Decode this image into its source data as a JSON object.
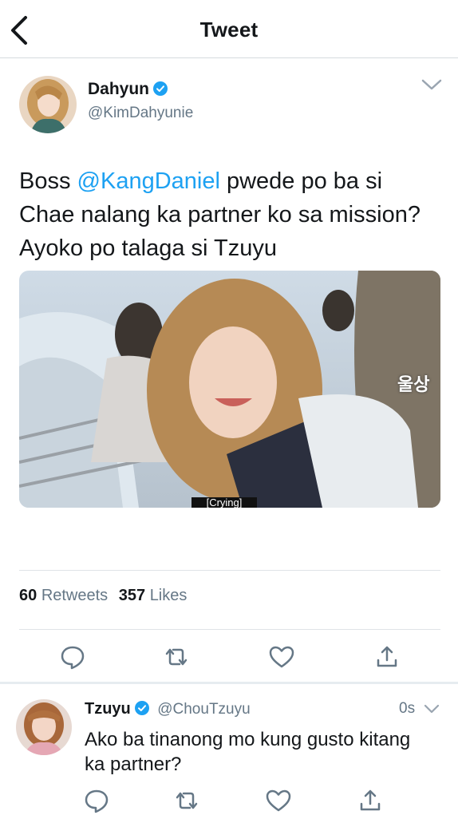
{
  "header": {
    "title": "Tweet",
    "back_icon": "back-chevron-icon"
  },
  "tweet": {
    "author_name": "Dahyun",
    "author_handle": "@KimDahyunie",
    "text_before": "Boss ",
    "mention": "@KangDaniel",
    "text_after": " pwede po ba si Chae nalang ka partner ko sa mission? Ayoko po talaga si Tzuyu",
    "image_caption": "울상",
    "image_subtitle": "[Crying]",
    "retweets_count": "60",
    "retweets_label": "Retweets",
    "likes_count": "357",
    "likes_label": "Likes",
    "actions": [
      "reply-icon",
      "retweet-icon",
      "like-icon",
      "share-icon"
    ]
  },
  "reply": {
    "author_name": "Tzuyu",
    "author_handle": "@ChouTzuyu",
    "time": "0s",
    "text": "Ako ba tinanong mo kung gusto kitang ka partner?"
  },
  "colors": {
    "accent": "#1da1f2",
    "secondary_text": "#657786",
    "icon": "#657786",
    "divider": "#dfe3e7"
  }
}
